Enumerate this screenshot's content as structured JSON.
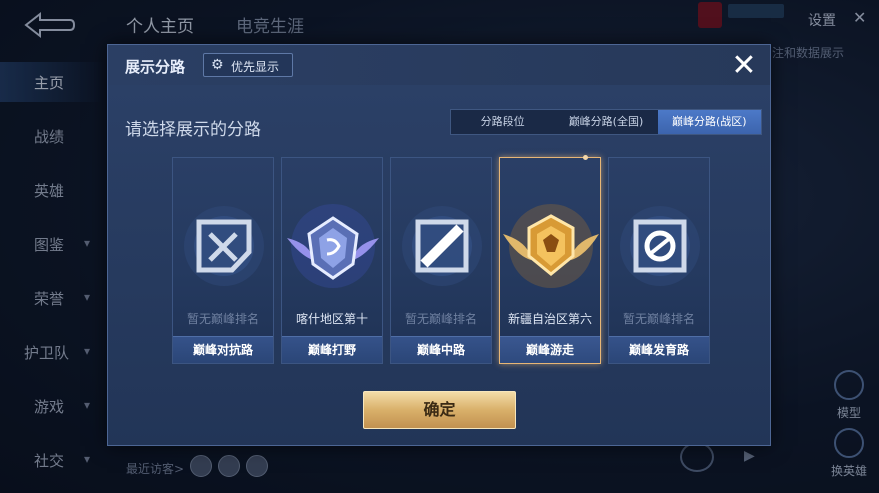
{
  "background": {
    "top_tabs": [
      "个人主页",
      "电竞生涯"
    ],
    "settings_label": "设置",
    "side_nav": [
      {
        "label": "主页",
        "active": true,
        "chevron": false
      },
      {
        "label": "战绩",
        "active": false,
        "chevron": false
      },
      {
        "label": "英雄",
        "active": false,
        "chevron": false
      },
      {
        "label": "图鉴",
        "active": false,
        "chevron": true
      },
      {
        "label": "荣誉",
        "active": false,
        "chevron": true
      },
      {
        "label": "护卫队",
        "active": false,
        "chevron": true
      },
      {
        "label": "游戏",
        "active": false,
        "chevron": true
      },
      {
        "label": "社交",
        "active": false,
        "chevron": true
      }
    ],
    "right_hint": "注和数据展示",
    "model_label": "模型",
    "swap_hero_label": "换英雄",
    "recent_visitors_label": "最近访客>"
  },
  "dialog": {
    "title": "展示分路",
    "priority_button": "优先显示",
    "prompt": "请选择展示的分路",
    "tabs": [
      {
        "label": "分路段位",
        "active": false
      },
      {
        "label": "巅峰分路(全国)",
        "active": false
      },
      {
        "label": "巅峰分路(战区)",
        "active": true
      }
    ],
    "cards": [
      {
        "rank_text": "暂无巅峰排名",
        "role": "巅峰对抗路",
        "selected": false,
        "emblem": "clash-lane-icon"
      },
      {
        "rank_text": "喀什地区第十",
        "role": "巅峰打野",
        "selected": false,
        "emblem": "jungle-badge-icon"
      },
      {
        "rank_text": "暂无巅峰排名",
        "role": "巅峰中路",
        "selected": false,
        "emblem": "mid-lane-icon"
      },
      {
        "rank_text": "新疆自治区第六",
        "role": "巅峰游走",
        "selected": true,
        "emblem": "roam-badge-icon"
      },
      {
        "rank_text": "暂无巅峰排名",
        "role": "巅峰发育路",
        "selected": false,
        "emblem": "farm-lane-icon"
      }
    ],
    "confirm_label": "确定"
  },
  "colors": {
    "accent_blue": "#3c64ad",
    "selected_gold": "#e7b676",
    "confirm_gold": "#d9b06a"
  }
}
